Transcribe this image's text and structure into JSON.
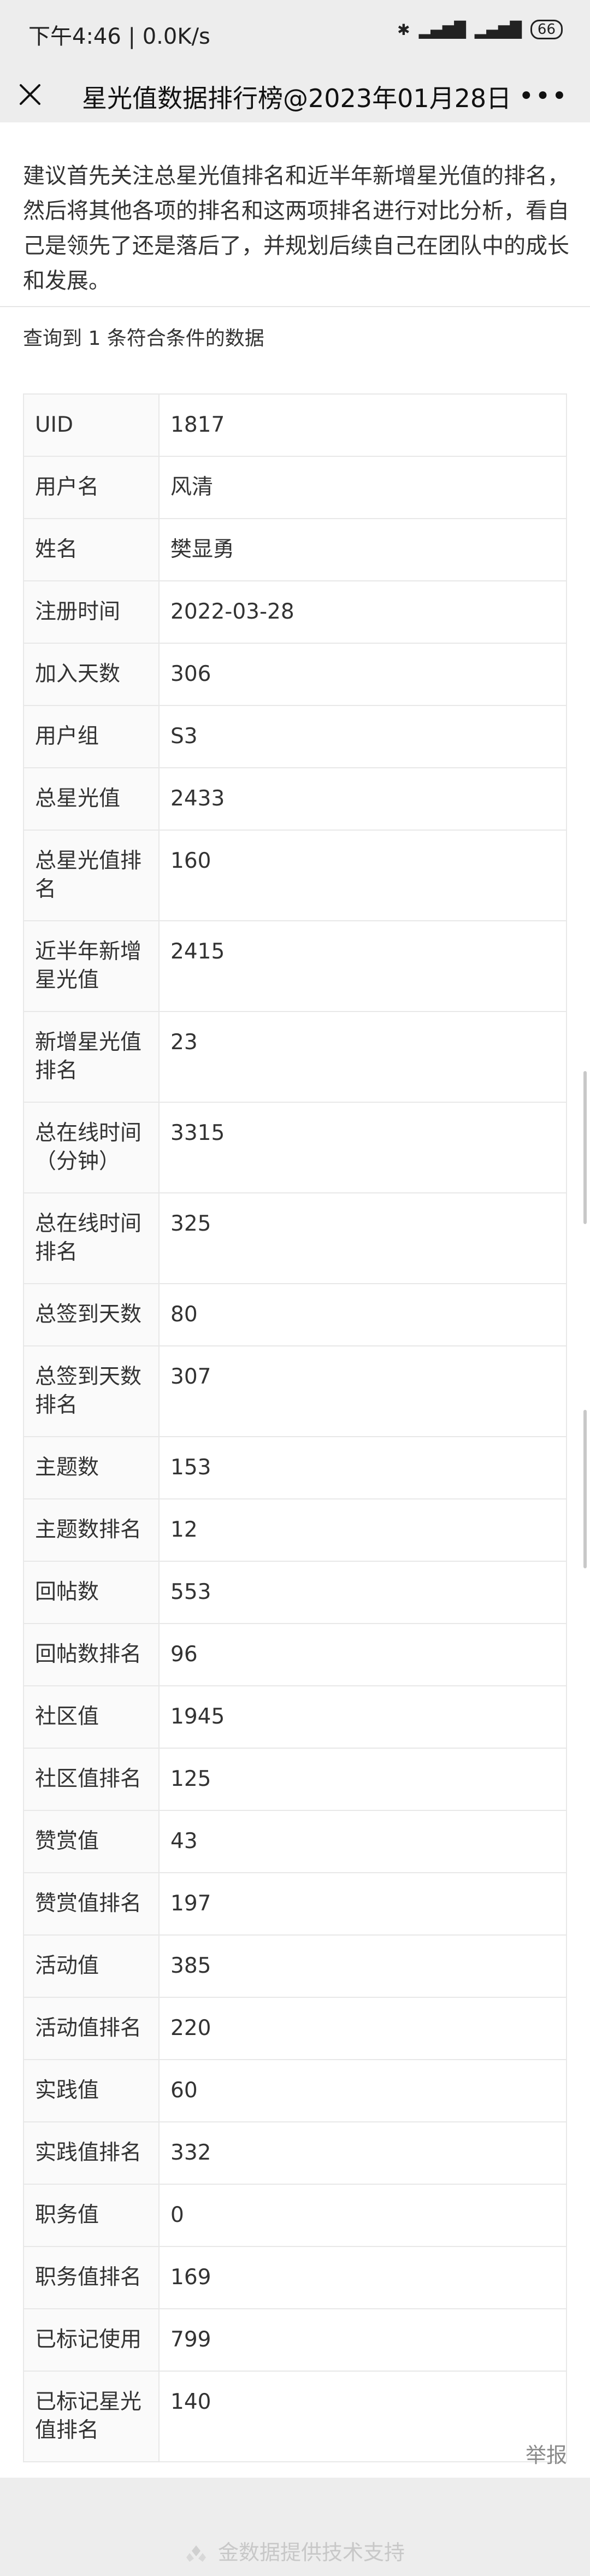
{
  "status_bar": {
    "time_speed": "下午4:46 | 0.0K/s",
    "battery": "66"
  },
  "nav": {
    "title": "星光值数据排行榜@2023年01月28日",
    "more": "•••"
  },
  "tip": "建议首先关注总星光值排名和近半年新增星光值的排名，然后将其他各项的排名和这两项排名进行对比分析，看自己是领先了还是落后了，并规划后续自己在团队中的成长和发展。",
  "query_info": "查询到 1 条符合条件的数据",
  "rows": [
    {
      "key": "UID",
      "value": "1817"
    },
    {
      "key": "用户名",
      "value": "风清"
    },
    {
      "key": "姓名",
      "value": "樊显勇"
    },
    {
      "key": "注册时间",
      "value": "2022-03-28"
    },
    {
      "key": "加入天数",
      "value": "306"
    },
    {
      "key": "用户组",
      "value": "S3"
    },
    {
      "key": "总星光值",
      "value": "2433"
    },
    {
      "key": "总星光值排名",
      "value": "160"
    },
    {
      "key": "近半年新增星光值",
      "value": "2415"
    },
    {
      "key": "新增星光值排名",
      "value": "23"
    },
    {
      "key": "总在线时间（分钟）",
      "value": "3315"
    },
    {
      "key": "总在线时间排名",
      "value": "325"
    },
    {
      "key": "总签到天数",
      "value": "80"
    },
    {
      "key": "总签到天数排名",
      "value": "307"
    },
    {
      "key": "主题数",
      "value": "153"
    },
    {
      "key": "主题数排名",
      "value": "12"
    },
    {
      "key": "回帖数",
      "value": "553"
    },
    {
      "key": "回帖数排名",
      "value": "96"
    },
    {
      "key": "社区值",
      "value": "1945"
    },
    {
      "key": "社区值排名",
      "value": "125"
    },
    {
      "key": "赞赏值",
      "value": "43"
    },
    {
      "key": "赞赏值排名",
      "value": "197"
    },
    {
      "key": "活动值",
      "value": "385"
    },
    {
      "key": "活动值排名",
      "value": "220"
    },
    {
      "key": "实践值",
      "value": "60"
    },
    {
      "key": "实践值排名",
      "value": "332"
    },
    {
      "key": "职务值",
      "value": "0"
    },
    {
      "key": "职务值排名",
      "value": "169"
    },
    {
      "key": "已标记使用",
      "value": "799"
    },
    {
      "key": "已标记星光值排名",
      "value": "140"
    }
  ],
  "report_label": "举报",
  "footer": "金数据提供技术支持",
  "icons": {
    "close": "close-icon",
    "more": "more-icon",
    "footer_logo": "jinshuju-logo-icon"
  }
}
